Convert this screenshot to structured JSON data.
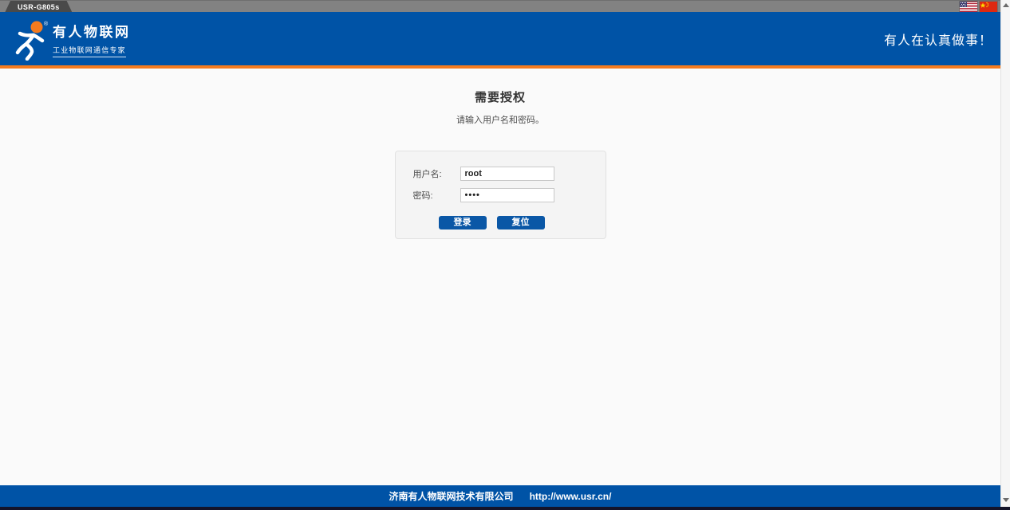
{
  "window": {
    "tab_title": "USR-G805s"
  },
  "header": {
    "brand_name": "有人物联网",
    "brand_tagline": "工业物联网通信专家",
    "slogan": "有人在认真做事！"
  },
  "main": {
    "title": "需要授权",
    "subtitle": "请输入用户名和密码。",
    "form": {
      "username_label": "用户名:",
      "username_value": "root",
      "password_label": "密码:",
      "password_value": "••••",
      "login_button": "登录",
      "reset_button": "复位"
    }
  },
  "footer": {
    "company": "济南有人物联网技术有限公司",
    "url": "http://www.usr.cn/"
  },
  "icons": {
    "flag_us": "us-flag",
    "flag_cn": "cn-flag",
    "logo": "usr-running-man-logo"
  },
  "colors": {
    "header_blue": "#0053a6",
    "accent_orange": "#f47b1f",
    "button_blue": "#0a57a6",
    "topbar_gray": "#828282",
    "page_background": "#fafafa",
    "card_background": "#f4f4f4"
  }
}
